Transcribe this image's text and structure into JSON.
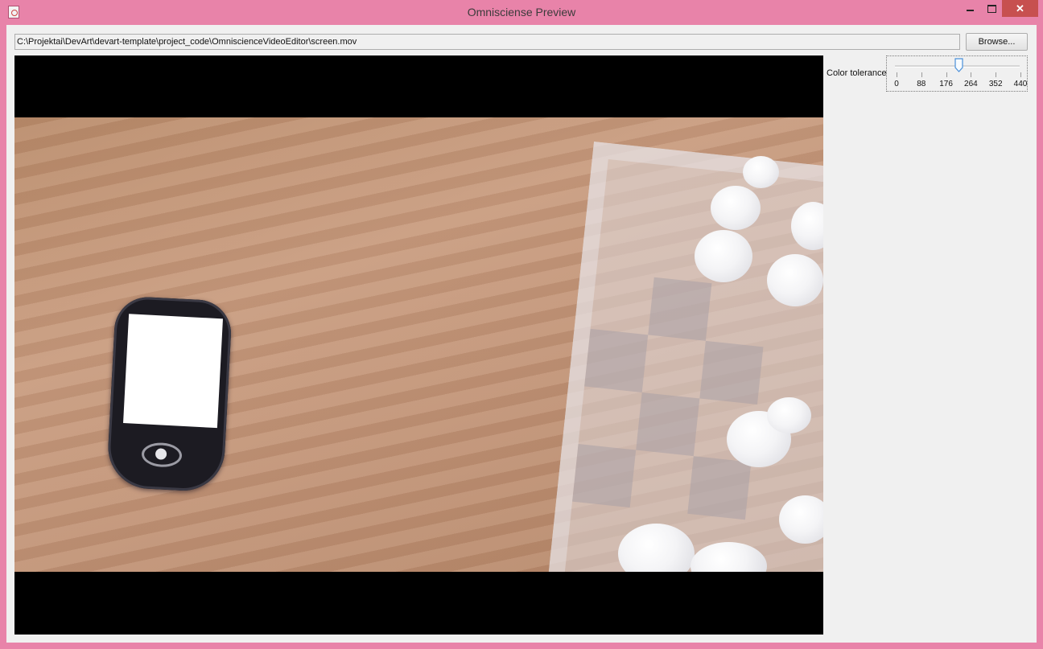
{
  "window": {
    "title": "Omnisciense Preview",
    "controls": {
      "minimize": "–",
      "maximize": "□",
      "close": "✕"
    }
  },
  "file": {
    "path": "C:\\Projektai\\DevArt\\devart-template\\project_code\\OmniscienceVideoEditor\\screen.mov",
    "browse_label": "Browse..."
  },
  "controls": {
    "tolerance_label": "Color tolerance",
    "slider": {
      "min": 0,
      "max": 440,
      "value": 220,
      "tick_labels": [
        "0",
        "88",
        "176",
        "264",
        "352",
        "440"
      ]
    }
  },
  "colors": {
    "window_frame": "#e883a9",
    "close_button": "#c7504f",
    "panel_bg": "#f0f0f0",
    "slider_thumb": "#4a90d9"
  },
  "icons": {
    "app": "java-cup-icon"
  }
}
